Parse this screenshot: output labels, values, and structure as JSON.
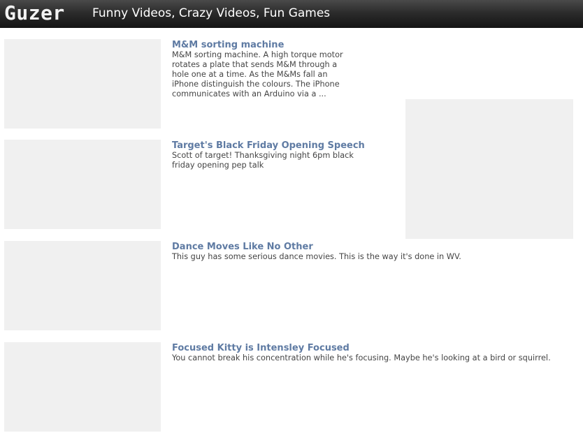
{
  "header": {
    "logo": "Guzer",
    "tagline": "Funny Videos, Crazy Videos, Fun Games"
  },
  "videos": [
    {
      "title": "M&M sorting machine",
      "description": "M&M sorting machine. A high torque motor rotates a plate that sends M&M through a hole one at a time. As the M&Ms fall an iPhone distinguish the colours. The iPhone communicates with an Arduino via a ..."
    },
    {
      "title": "Target's Black Friday Opening Speech",
      "description": "Scott of target! Thanksgiving night 6pm black friday opening pep talk"
    },
    {
      "title": "Dance Moves Like No Other",
      "description": "This guy has some serious dance movies. This is the way it's done in WV."
    },
    {
      "title": "Focused Kitty is Intensley Focused",
      "description": "You cannot break his concentration while he's focusing. Maybe he's looking at a bird or squirrel."
    }
  ]
}
